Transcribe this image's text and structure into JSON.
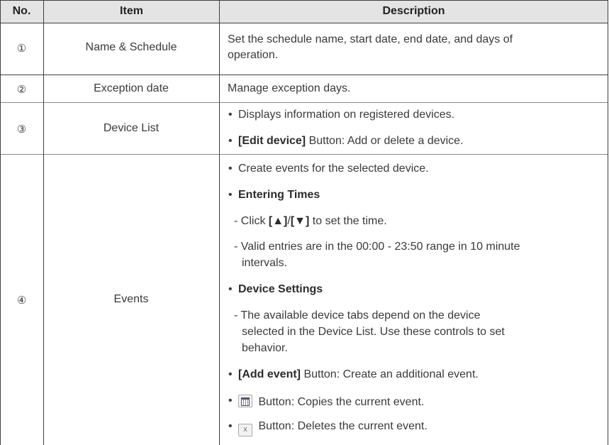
{
  "header": {
    "no": "No.",
    "item": "Item",
    "description": "Description"
  },
  "rows": [
    {
      "no": "①",
      "item": "Name & Schedule",
      "desc_line1": "Set the schedule name, start date, end date, and days of",
      "desc_line2": "operation."
    },
    {
      "no": "②",
      "item": "Exception date",
      "desc": "Manage exception days."
    },
    {
      "no": "③",
      "item": "Device List",
      "b1": "Displays information on registered devices.",
      "b2_bold": "[Edit device]",
      "b2_rest": " Button: Add or delete a device."
    },
    {
      "no": "④",
      "item": "Events",
      "b1": "Create events for the selected device.",
      "b2_bold": "Entering Times",
      "s1_pre": "- Click ",
      "s1_bold": "[▲]",
      "s1_mid": "/",
      "s1_bold2": "[▼]",
      "s1_rest": " to set the time.",
      "s2_l1": "- Valid entries are in the 00:00 - 23:50 range in 10 minute",
      "s2_l2": "intervals.",
      "b3_bold": "Device Settings",
      "s3_l1": "- The available device tabs depend on the device",
      "s3_l2": "selected in the Device List. Use these controls to set",
      "s3_l3": "behavior.",
      "b4_bold": "[Add event]",
      "b4_rest": " Button: Create an additional event.",
      "b5_text": " Button: Copies the current event.",
      "b6_icon": "x",
      "b6_text": " Button: Deletes the current event."
    }
  ]
}
